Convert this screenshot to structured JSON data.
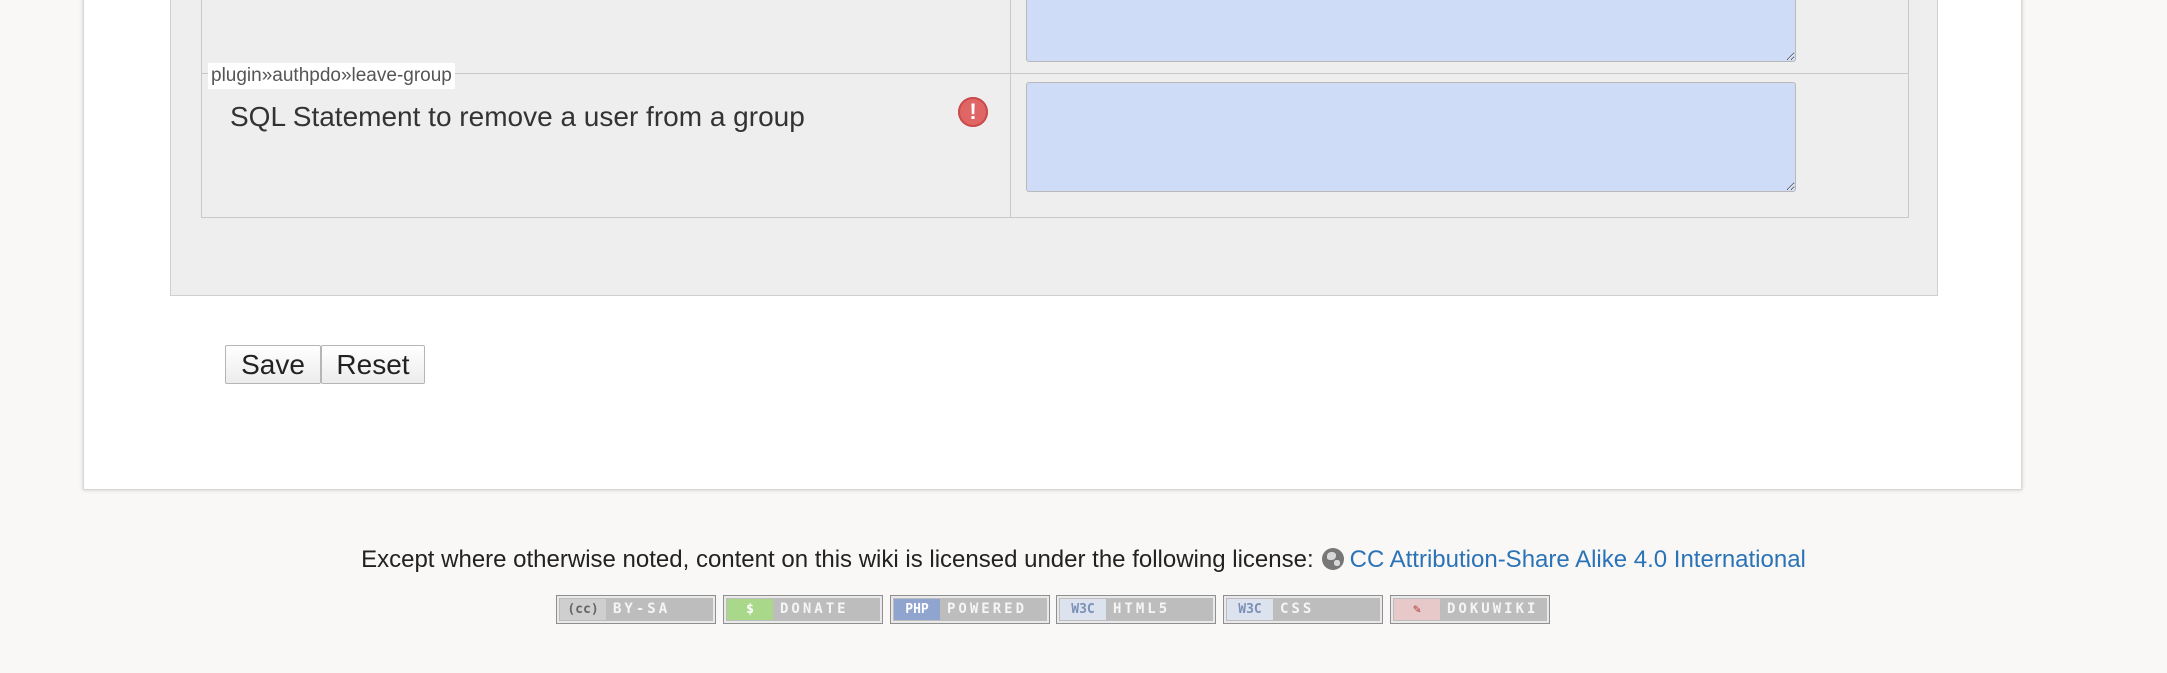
{
  "config": {
    "row_main": {
      "key": "plugin»authpdo»leave-group",
      "label": "SQL Statement to remove a user from a group",
      "warning_icon": "exclamation-circle-icon",
      "value": ""
    },
    "row_top": {
      "value": ""
    }
  },
  "buttons": {
    "save_label": "Save",
    "reset_label": "Reset"
  },
  "footer": {
    "license_prefix": "Except where otherwise noted, content on this wiki is licensed under the following license:",
    "license_link": "CC Attribution-Share Alike 4.0 International",
    "badges": [
      {
        "tag": "(cc)",
        "text": "BY-SA",
        "tag_color": "#cfcfcf"
      },
      {
        "tag": "$",
        "text": "DONATE",
        "tag_color": "#a9d88a"
      },
      {
        "tag": "PHP",
        "text": "POWERED",
        "tag_color": "#8fa4cf"
      },
      {
        "tag": "W3C",
        "text": "HTML5",
        "tag_color": "#cfd8e8"
      },
      {
        "tag": "W3C",
        "text": "CSS",
        "tag_color": "#cfd8e8"
      },
      {
        "tag": "✎",
        "text": "DOKUWIKI",
        "tag_color": "#e7c9c9"
      }
    ]
  },
  "colors": {
    "accent_link": "#2b73b7",
    "warning": "#e06666",
    "textarea_bg": "#cfdcf8"
  }
}
